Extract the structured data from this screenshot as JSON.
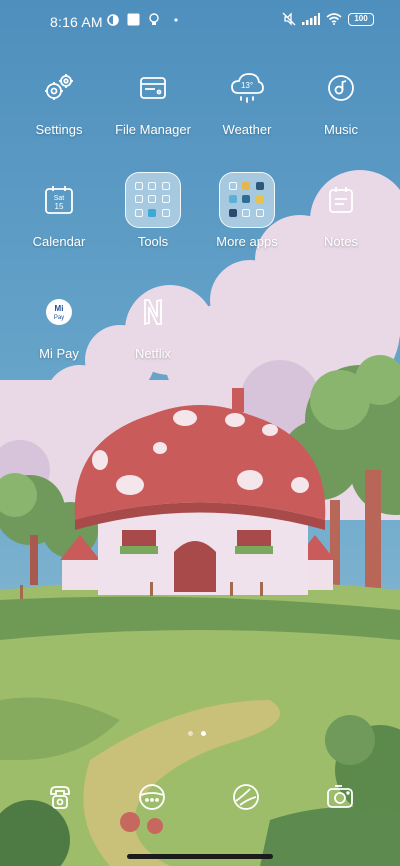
{
  "status_bar": {
    "time": "8:16 AM",
    "battery": "100",
    "icons": [
      "vpn-icon",
      "square-notification-icon",
      "bulb-icon",
      "dot-icon",
      "mute-icon",
      "signal-icon",
      "wifi-icon",
      "battery-icon"
    ]
  },
  "apps": [
    {
      "label": "Settings",
      "icon": "gears-icon"
    },
    {
      "label": "File Manager",
      "icon": "folder-card-icon"
    },
    {
      "label": "Weather",
      "icon": "cloud-rain-icon",
      "badge": "13°"
    },
    {
      "label": "Music",
      "icon": "record-icon"
    },
    {
      "label": "Calendar",
      "icon": "calendar-icon",
      "day": "Sat",
      "date": "15"
    },
    {
      "label": "Tools",
      "icon": "folder-icon"
    },
    {
      "label": "More apps",
      "icon": "folder-icon"
    },
    {
      "label": "Notes",
      "icon": "notes-icon"
    },
    {
      "label": "Mi Pay",
      "icon": "mipay-icon",
      "logo_text": "Mi Pay"
    },
    {
      "label": "Netflix",
      "icon": "netflix-icon"
    }
  ],
  "pager": {
    "pages": 2,
    "active": 2
  },
  "dock": [
    "phone-icon",
    "messages-icon",
    "browser-icon",
    "camera-icon"
  ],
  "colors": {
    "sky": "#5b9ac2",
    "cap": "#c95b5b",
    "grass": "#8fb768"
  }
}
